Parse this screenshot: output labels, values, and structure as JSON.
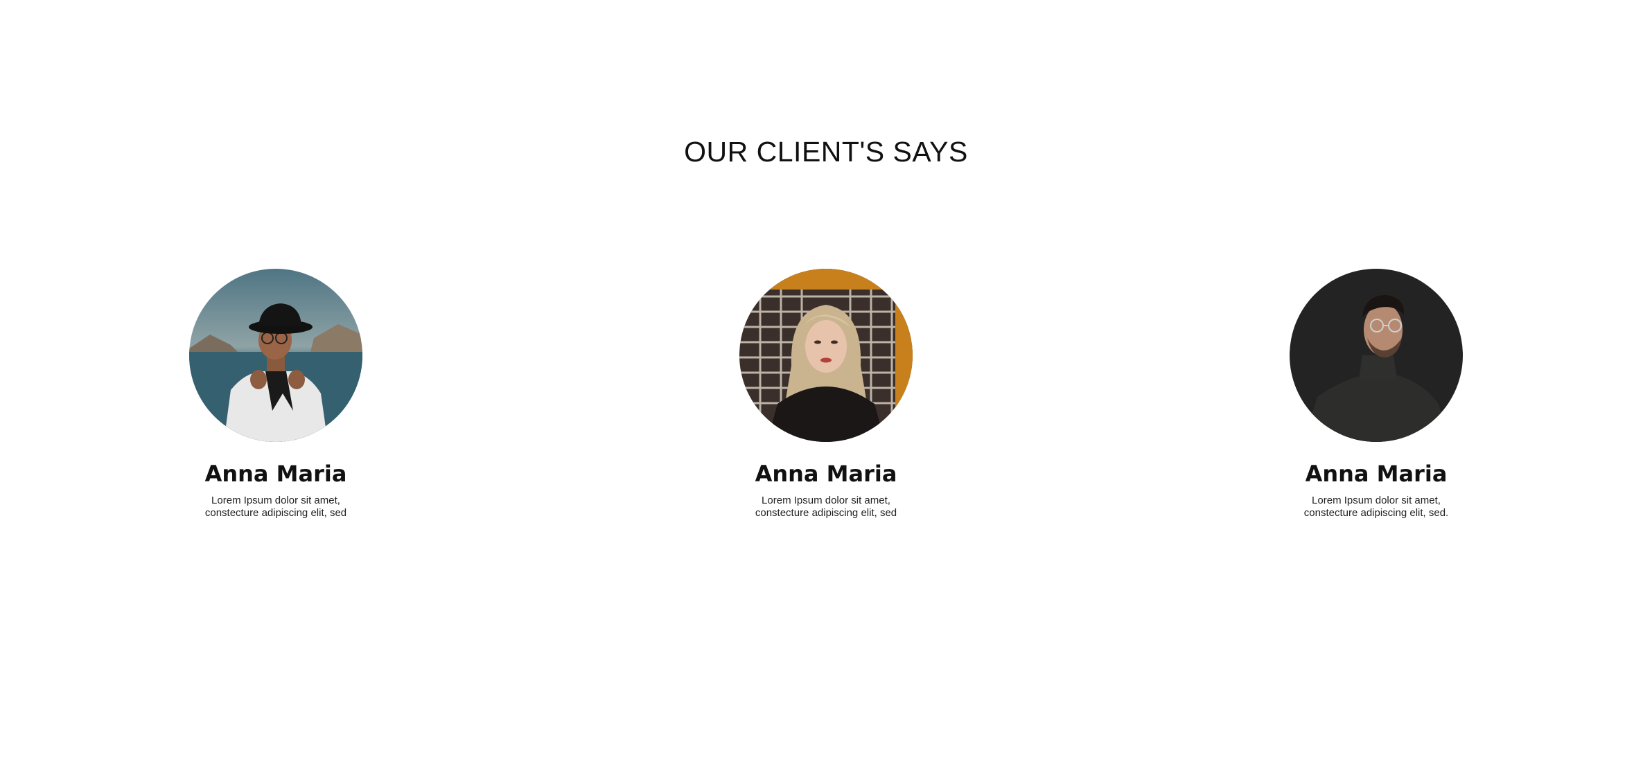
{
  "section": {
    "title": "OUR CLIENT'S SAYS"
  },
  "clients": [
    {
      "name": "Anna Maria",
      "text": "Lorem Ipsum dolor sit amet, constecture adipiscing elit, sed",
      "photo": "woman-in-hat-photo"
    },
    {
      "name": "Anna Maria",
      "text": "Lorem Ipsum dolor sit amet, constecture adipiscing elit, sed",
      "photo": "blonde-woman-photo"
    },
    {
      "name": "Anna Maria",
      "text": "Lorem Ipsum dolor sit amet, constecture adipiscing elit, sed.",
      "photo": "man-with-glasses-photo"
    }
  ]
}
